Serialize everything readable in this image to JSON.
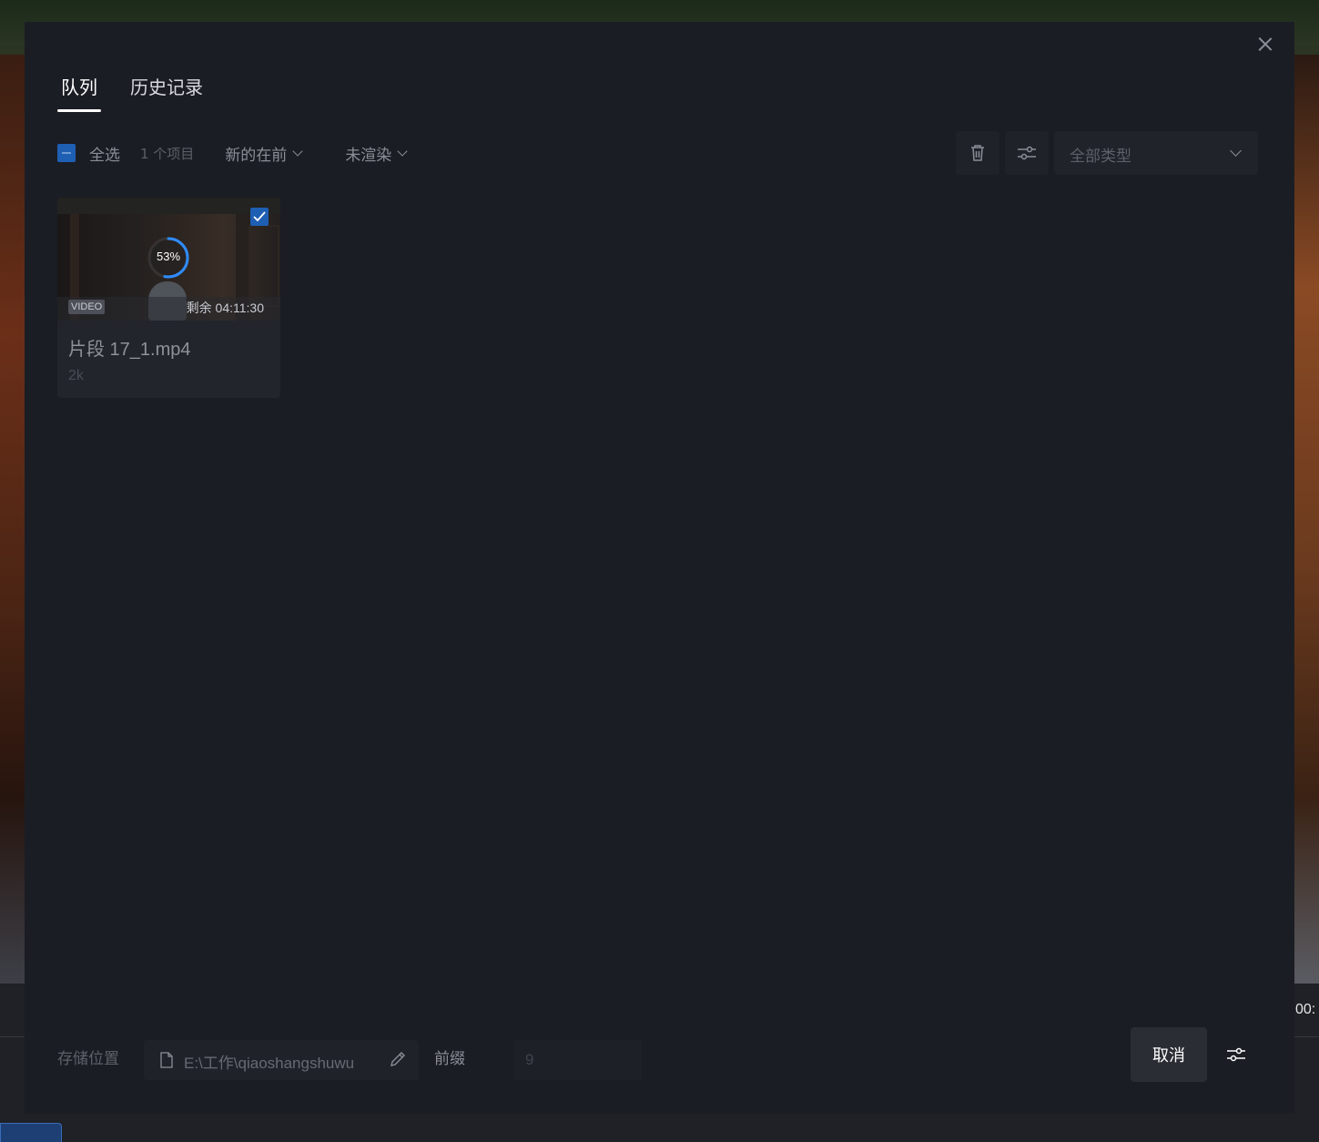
{
  "tabs": [
    {
      "label": "队列",
      "active": true
    },
    {
      "label": "历史记录",
      "active": false
    }
  ],
  "toolbar": {
    "select_all_label": "全选",
    "item_count": "1 个项目",
    "sort_label": "新的在前",
    "status_filter_label": "未渲染",
    "type_filter_value": "全部类型"
  },
  "queue_items": [
    {
      "type_badge": "VIDEO",
      "progress_percent": 53,
      "progress_text": "53%",
      "remaining_text": "剩余  04:11:30",
      "filename": "片段 17_1.mp4",
      "resolution": "2k",
      "selected": true
    }
  ],
  "footer": {
    "storage_label": "存储位置",
    "storage_path": "E:\\工作\\qiaoshangshuwu",
    "prefix_label": "前缀",
    "prefix_value": "9",
    "cancel_label": "取消"
  },
  "background": {
    "timecode": "00:"
  },
  "colors": {
    "modal_bg": "#1b1d24",
    "accent": "#1e5fb3",
    "progress_ring": "#2f8cff"
  }
}
